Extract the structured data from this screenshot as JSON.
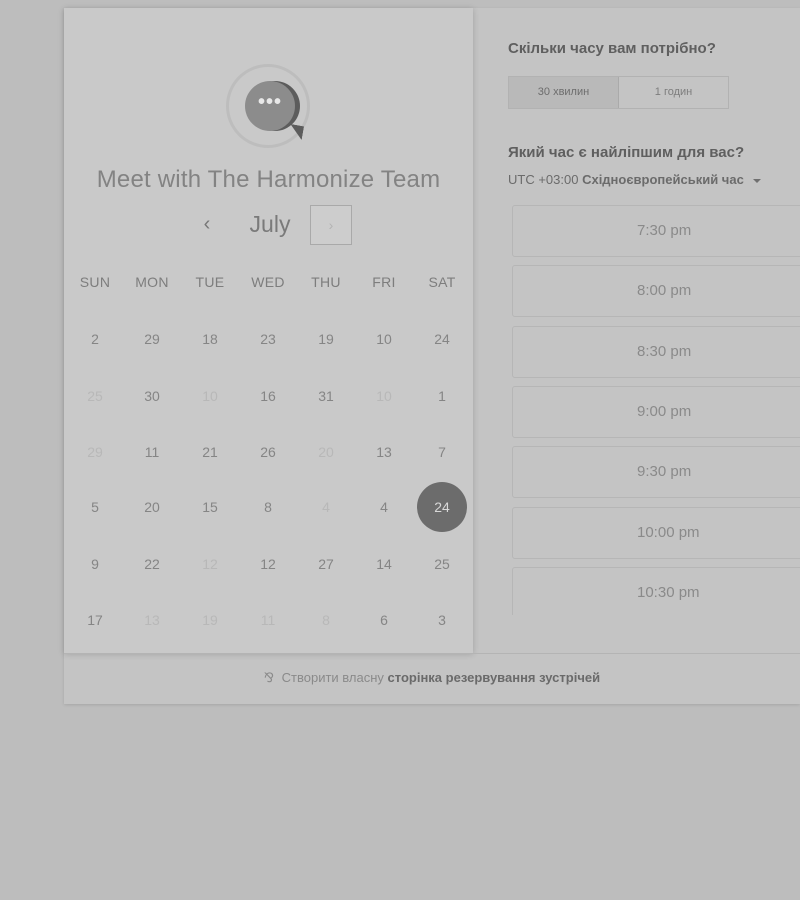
{
  "calendar": {
    "title": "Meet with The Harmonize Team",
    "month": "July",
    "prev_glyph": "‹",
    "next_glyph": "›",
    "weekdays": [
      "SUN",
      "MON",
      "TUE",
      "WED",
      "THU",
      "FRI",
      "SAT"
    ],
    "weeks": [
      [
        {
          "d": "2",
          "m": false
        },
        {
          "d": "29",
          "m": false
        },
        {
          "d": "18",
          "m": false
        },
        {
          "d": "23",
          "m": false
        },
        {
          "d": "19",
          "m": false
        },
        {
          "d": "10",
          "m": false
        },
        {
          "d": "24",
          "m": false
        }
      ],
      [
        {
          "d": "25",
          "m": true
        },
        {
          "d": "30",
          "m": false
        },
        {
          "d": "10",
          "m": true
        },
        {
          "d": "16",
          "m": false
        },
        {
          "d": "31",
          "m": false
        },
        {
          "d": "10",
          "m": true
        },
        {
          "d": "1",
          "m": false
        }
      ],
      [
        {
          "d": "29",
          "m": true
        },
        {
          "d": "11",
          "m": false
        },
        {
          "d": "21",
          "m": false
        },
        {
          "d": "26",
          "m": false
        },
        {
          "d": "20",
          "m": true
        },
        {
          "d": "13",
          "m": false
        },
        {
          "d": "7",
          "m": false
        }
      ],
      [
        {
          "d": "5",
          "m": false
        },
        {
          "d": "20",
          "m": false
        },
        {
          "d": "15",
          "m": false
        },
        {
          "d": "8",
          "m": false
        },
        {
          "d": "4",
          "m": true
        },
        {
          "d": "4",
          "m": false
        },
        {
          "d": "24",
          "m": false,
          "selected": true
        }
      ],
      [
        {
          "d": "9",
          "m": false
        },
        {
          "d": "22",
          "m": false
        },
        {
          "d": "12",
          "m": true
        },
        {
          "d": "12",
          "m": false
        },
        {
          "d": "27",
          "m": false
        },
        {
          "d": "14",
          "m": false
        },
        {
          "d": "25",
          "m": false
        }
      ],
      [
        {
          "d": "17",
          "m": false
        },
        {
          "d": "13",
          "m": true
        },
        {
          "d": "19",
          "m": true
        },
        {
          "d": "11",
          "m": true
        },
        {
          "d": "8",
          "m": true
        },
        {
          "d": "6",
          "m": false
        },
        {
          "d": "3",
          "m": false
        }
      ]
    ]
  },
  "duration": {
    "question": "Скільки часу вам потрібно?",
    "options": [
      "30 хвилин",
      "1 годин"
    ],
    "selected": "30 хвилин"
  },
  "time": {
    "question": "Який час є найліпшим для вас?",
    "timezone_offset": "UTC +03:00",
    "timezone_name": "Східноєвропейський час",
    "slots": [
      "7:30 pm",
      "8:00 pm",
      "8:30 pm",
      "9:00 pm",
      "9:30 pm",
      "10:00 pm",
      "10:30 pm"
    ]
  },
  "footer": {
    "prefix": "Створити власну",
    "bold": "сторінка резервування зустрічей"
  },
  "colors": {
    "selected_day": "#6c6c6c",
    "background": "#bdbdbd"
  },
  "icons": {
    "logo": "chat-bubble-logo-icon",
    "footer": "sprocket-icon"
  }
}
